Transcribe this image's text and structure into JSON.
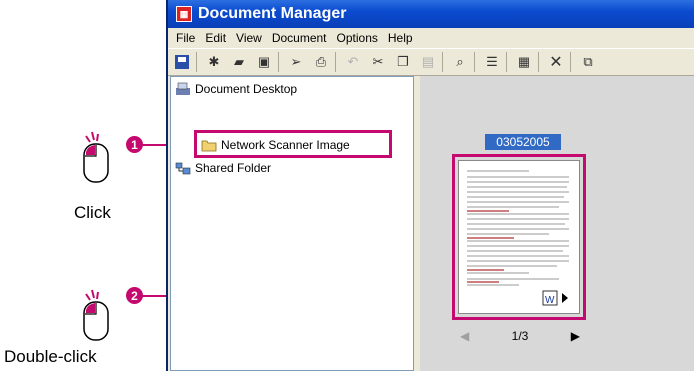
{
  "window": {
    "title": "Document Manager"
  },
  "menu": [
    "File",
    "Edit",
    "View",
    "Document",
    "Options",
    "Help"
  ],
  "toolbar": [
    "save-icon",
    "new-folder-icon",
    "open-folder-icon",
    "disk-icon",
    "send-icon",
    "print-icon",
    "undo-icon",
    "cut-icon",
    "copy-icon",
    "paste-icon",
    "zoom-icon",
    "list-view-icon",
    "thumbnail-view-icon",
    "delete-icon",
    "copy-page-icon"
  ],
  "tree": {
    "root": "Document Desktop",
    "items": [
      "Network Scanner Image",
      "Shared Folder"
    ]
  },
  "thumbnail": {
    "label": "03052005",
    "page_indicator": "1/3"
  },
  "callouts": {
    "step1_number": "1",
    "step1_label": "Click",
    "step2_number": "2",
    "step2_label": "Double-click"
  },
  "colors": {
    "highlight": "#c40a6e",
    "title_bar": "#0b4bd0",
    "selection": "#316ac5"
  }
}
